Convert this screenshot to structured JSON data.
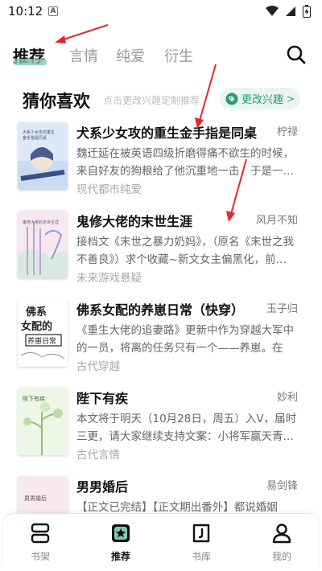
{
  "status_bar": {
    "time": "10:12",
    "a_badge": "A"
  },
  "top_tabs": [
    {
      "label": "推荐",
      "active": true
    },
    {
      "label": "言情",
      "active": false
    },
    {
      "label": "纯爱",
      "active": false
    },
    {
      "label": "衍生",
      "active": false
    }
  ],
  "section": {
    "title": "猜你喜欢",
    "hint": "点击更改兴趣定制推荐",
    "interest_button": "更改兴趣",
    "interest_chevron": ">"
  },
  "books": [
    {
      "title": "犬系少女攻的重生金手指是同桌",
      "author": "柠禄",
      "description": "魏迁延在被英语四级折磨得痛不欲生的时候，来自好友的狗粮给了他沉重地一击，于是一…",
      "tag": "现代都市纯爱"
    },
    {
      "title": "鬼修大佬的末世生涯",
      "author": "风月不知",
      "description": "接档文《末世之暴力奶妈》，（原名《末世之我不善良》）求个收藏~新文女主偏黑化，前…",
      "tag": "未来游戏悬疑"
    },
    {
      "title": "佛系女配的养崽日常（快穿）",
      "author": "玉子归",
      "description": "《重生大佬的追妻路》更新中作为穿越大军中的一员，将离的任务只有一个——养崽。在每…",
      "tag": "古代穿越"
    },
    {
      "title": "陛下有疾",
      "author": "妙利",
      "description": "本文将于明天（10月28日，周五）入V，届时三更，请大家继续支持文案：小将军赢天青…",
      "tag": "古代言情"
    },
    {
      "title": "男男婚后",
      "author": "易剑锋",
      "description": "【正文已完结】【正文期出番外】都说婚姻是…",
      "tag": ""
    }
  ],
  "covers": [
    {
      "text": "",
      "bg": "#dce9f7"
    },
    {
      "text": "",
      "bg": "#f6e7f0"
    },
    {
      "text": "佛系\n女配的\n养崽日常",
      "bg": "#ffffff"
    },
    {
      "text": "陛下有疾",
      "bg": "#eef6e6"
    },
    {
      "text": "男男婚后",
      "bg": "#f7e9ee"
    }
  ],
  "bottom_nav": [
    {
      "label": "书架",
      "active": false,
      "icon": "bookshelf-icon"
    },
    {
      "label": "推荐",
      "active": true,
      "icon": "recommend-icon"
    },
    {
      "label": "书库",
      "active": false,
      "icon": "library-icon"
    },
    {
      "label": "我的",
      "active": false,
      "icon": "profile-icon"
    }
  ],
  "colors": {
    "accent": "#2b9a77",
    "annotation": "#e8262c"
  }
}
